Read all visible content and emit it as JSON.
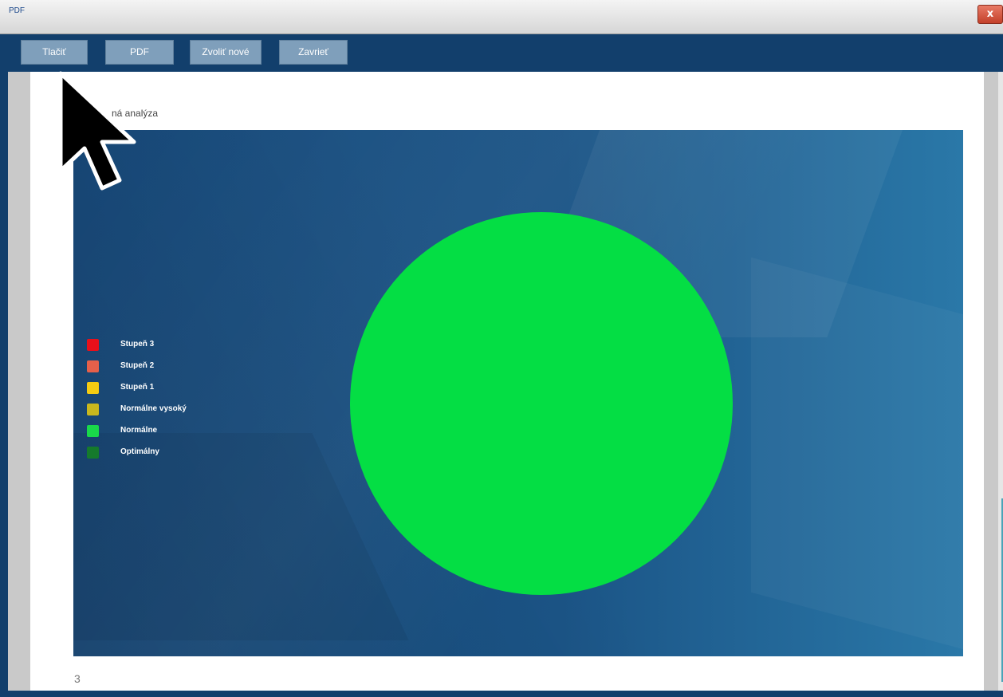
{
  "window": {
    "title": "PDF",
    "close_label": "x"
  },
  "toolbar": {
    "print_label": "Tlačiť",
    "pdf_label": "PDF",
    "choose_new_label": "Zvoliť nové",
    "close_label": "Zavrieť"
  },
  "page": {
    "heading": "ná analýza",
    "page_number": "3"
  },
  "chart_data": {
    "type": "pie",
    "legend_position": "left",
    "legend": [
      {
        "label": "Stupeň 3",
        "color": "#e8101a"
      },
      {
        "label": "Stupeň 2",
        "color": "#e6604a"
      },
      {
        "label": "Stupeň 1",
        "color": "#f5cc12"
      },
      {
        "label": "Normálne vysoký",
        "color": "#c9b81e"
      },
      {
        "label": "Normálne",
        "color": "#19d94a"
      },
      {
        "label": "Optimálny",
        "color": "#157a2c"
      }
    ],
    "slices": [
      {
        "label": "Normálne",
        "value": 100,
        "color": "#04de44"
      }
    ]
  },
  "icons": {
    "cursor": "mouse-pointer-icon",
    "close": "close-icon"
  }
}
